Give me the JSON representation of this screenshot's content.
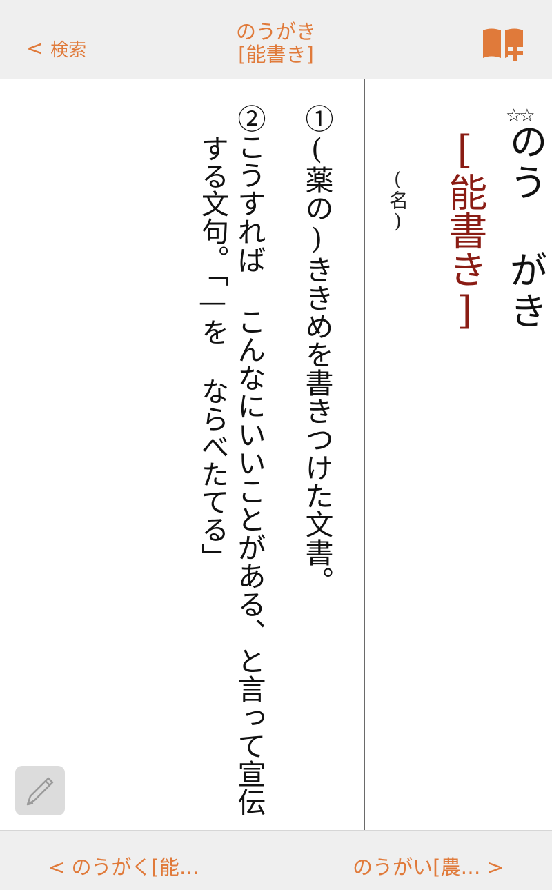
{
  "nav": {
    "back_chevron": "<",
    "back_label": "検索",
    "title_reading": "のうがき",
    "title_kanji": "[能書き]",
    "bookmark_icon": "book-plus-icon"
  },
  "entry": {
    "importance_stars": "☆☆",
    "reading": "のう がき",
    "kanji": "[能書き]",
    "part_of_speech": "(名)",
    "definitions": [
      "①(薬の)ききめを書きつけた文書。",
      "②こうすれば こんなにいいことがある、と言って宣伝"
    ],
    "definition_continuation": "する文句。「—を ならべたてる」"
  },
  "tools": {
    "pen_icon": "pen-icon"
  },
  "footer": {
    "prev_label": "<  のうがく[能…",
    "next_label": "のうがい[農…  >"
  },
  "colors": {
    "accent": "#e07a3a",
    "kanji": "#8a1c14",
    "bar": "#efefef"
  }
}
